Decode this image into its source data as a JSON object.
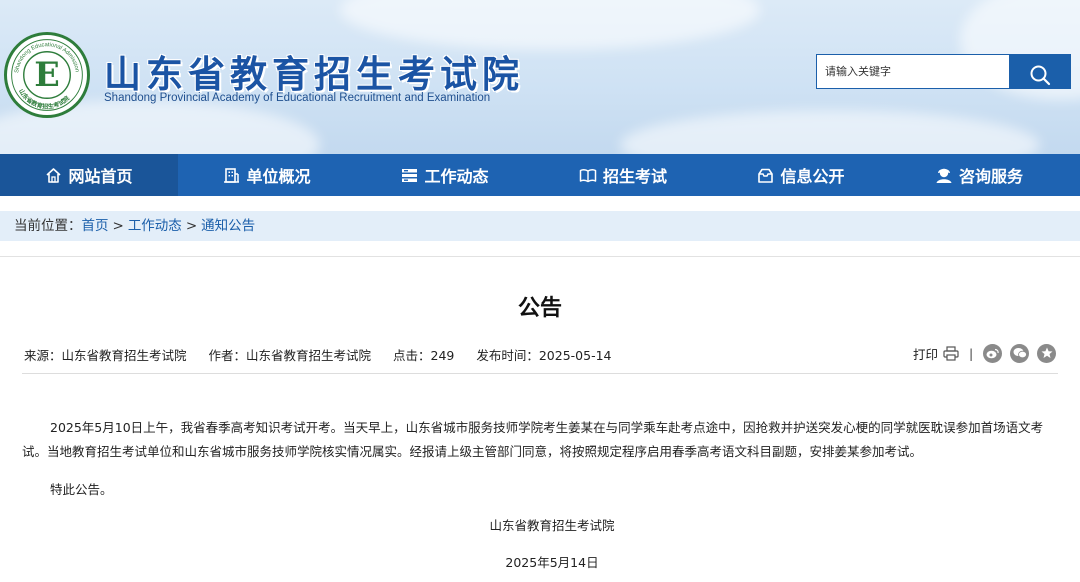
{
  "header": {
    "title": "山东省教育招生考试院",
    "subtitle": "Shandong Provincial Academy of Educational Recruitment and Examination",
    "logo": {
      "ring_text_top": "Shandong Educational Admission & Examination",
      "ring_text_bottom": "山东省教育招生考试院",
      "letter": "E",
      "colors": {
        "ring": "#2e7d3b",
        "letter": "#2e7d3b"
      }
    }
  },
  "search": {
    "placeholder": "请输入关键字",
    "button_icon": "search-icon"
  },
  "nav": {
    "items": [
      {
        "label": "网站首页",
        "icon": "home-icon",
        "active": true
      },
      {
        "label": "单位概况",
        "icon": "building-icon",
        "active": false
      },
      {
        "label": "工作动态",
        "icon": "news-list-icon",
        "active": false
      },
      {
        "label": "招生考试",
        "icon": "open-book-icon",
        "active": false
      },
      {
        "label": "信息公开",
        "icon": "inbox-icon",
        "active": false
      },
      {
        "label": "咨询服务",
        "icon": "user-service-icon",
        "active": false
      }
    ]
  },
  "breadcrumb": {
    "prefix": "当前位置：",
    "items": [
      "首页",
      "工作动态",
      "通知公告"
    ],
    "separator": ">"
  },
  "article": {
    "title": "公告",
    "meta": {
      "source": "来源：山东省教育招生考试院",
      "author": "作者：山东省教育招生考试院",
      "clicks": "点击：249",
      "published": "发布时间：2025-05-14"
    },
    "tools": {
      "print_label": "打印",
      "separator": "|",
      "share_icons": [
        "weibo-icon",
        "wechat-icon",
        "favorite-icon"
      ]
    },
    "paragraphs": [
      "2025年5月10日上午，我省春季高考知识考试开考。当天早上，山东省城市服务技师学院考生姜某在与同学乘车赴考点途中，因抢救并护送突发心梗的同学就医耽误参加首场语文考试。当地教育招生考试单位和山东省城市服务技师学院核实情况属实。经报请上级主管部门同意，将按照规定程序启用春季高考语文科目副题，安排姜某参加考试。",
      "特此公告。"
    ],
    "signature": "山东省教育招生考试院",
    "date": "2025年5月14日"
  },
  "colors": {
    "primary_blue": "#1e63b2",
    "active_nav": "#1a5599",
    "breadcrumb_bg": "#e3eef9",
    "link": "#1b5faa"
  }
}
